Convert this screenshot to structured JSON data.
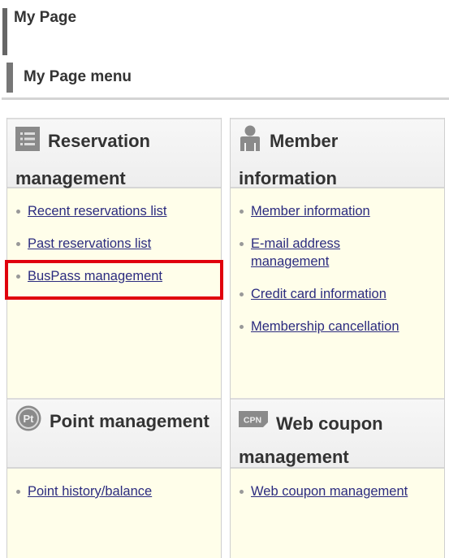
{
  "page": {
    "title": "My Page",
    "section_title": "My Page menu"
  },
  "panels": [
    {
      "id": "reservation",
      "icon": "list-icon",
      "title": "Reservation management",
      "links": [
        "Recent reservations list",
        "Past reservations list",
        "BusPass management"
      ]
    },
    {
      "id": "member",
      "icon": "person-icon",
      "title": "Member information",
      "links": [
        "Member information",
        "E-mail address management",
        "Credit card information",
        "Membership cancellation"
      ]
    },
    {
      "id": "point",
      "icon": "point-icon",
      "icon_text": "Pt",
      "title": "Point management",
      "links": [
        "Point history/balance"
      ]
    },
    {
      "id": "coupon",
      "icon": "coupon-icon",
      "icon_text": "CPN",
      "title": "Web coupon management",
      "links": [
        "Web coupon management"
      ]
    }
  ],
  "highlight": {
    "target": "BusPass management",
    "color": "#e0000d"
  },
  "colors": {
    "link": "#2b2b7f",
    "panel_body": "#fffeea",
    "panel_head": "#f2f2f2"
  }
}
